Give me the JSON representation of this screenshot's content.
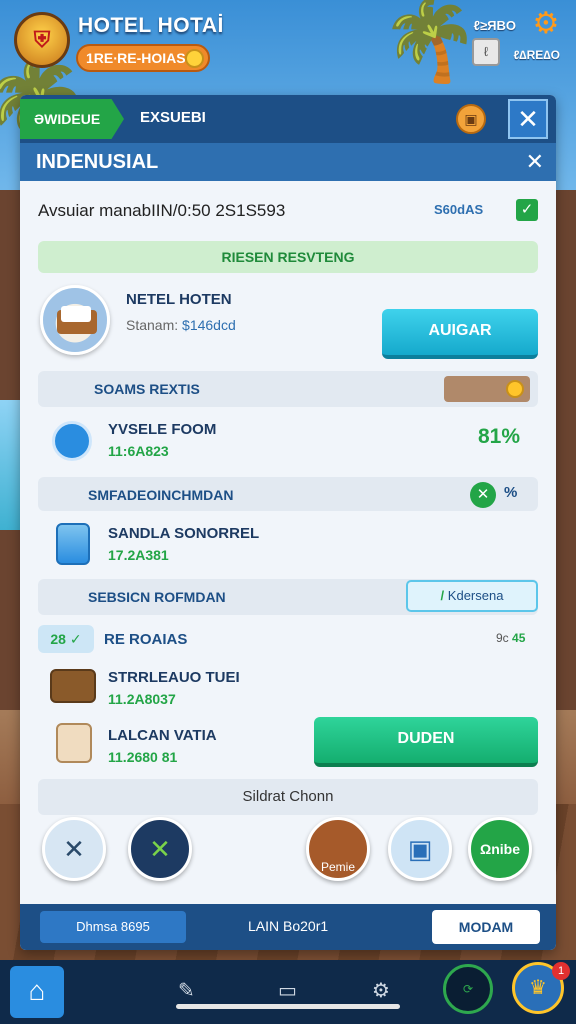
{
  "hud": {
    "title": "HOTEL HOTAİ",
    "currency_pill": "1RE∙RE-HOIAS",
    "right_label": "ℓ≥ЯВO",
    "right_box": "ℓ",
    "right_sub": "ℓ∆RE∆O"
  },
  "panel": {
    "tab_active": "ƏWIDEUE",
    "tab_other": "EXSUEBI",
    "subheader_title": "INDENUSIAL",
    "info_line": "Avsuiar manabIIN/0:50 2S1S593",
    "info_chip": "S60dAS",
    "section_1": "RIESEN RESVTENG",
    "room": {
      "name": "NETEL HOTEN",
      "price_label": "Stanam:",
      "price_value": "$146dcd",
      "button": "AUIGAR"
    },
    "section_2": "SOAMS REXTIS",
    "item_1": {
      "title": "YVSELE FOOM",
      "sub": "11:6A823",
      "value": "81%"
    },
    "section_3": "SMFADEOINCHMDAN",
    "section_3_pct": "%",
    "item_2": {
      "title": "SANDLA SONORREL",
      "sub": "17.2A381"
    },
    "section_4": "SEBSICN ROFMDAN",
    "section_4_chip_prefix": "/",
    "section_4_chip": "Kdersena",
    "count_chip": "28",
    "count_label": "RE ROAIAS",
    "count_right": "9c",
    "count_right_val": "45",
    "item_3": {
      "title": "STRRLEAUO TUEI",
      "sub": "11.2A8037"
    },
    "item_4": {
      "title": "LALCAN VATIA",
      "sub": "11.2680 81"
    },
    "button_green": "DUDEN",
    "status_bar": "Sildrat Chonn",
    "circle_4_label": "Pemie",
    "circle_6_label": "Ωnibe",
    "footer_left": "Dhmsa 8695",
    "footer_mid": "LAIN Bo20r1",
    "footer_right": "MODAM"
  },
  "nav": {
    "speed_label": "⟳",
    "avatar_badge": "1"
  },
  "colors": {
    "header": "#1d4f86",
    "accent_green": "#23a547",
    "accent_cyan": "#15a9cc",
    "panel_bg": "#f1f5fa"
  }
}
